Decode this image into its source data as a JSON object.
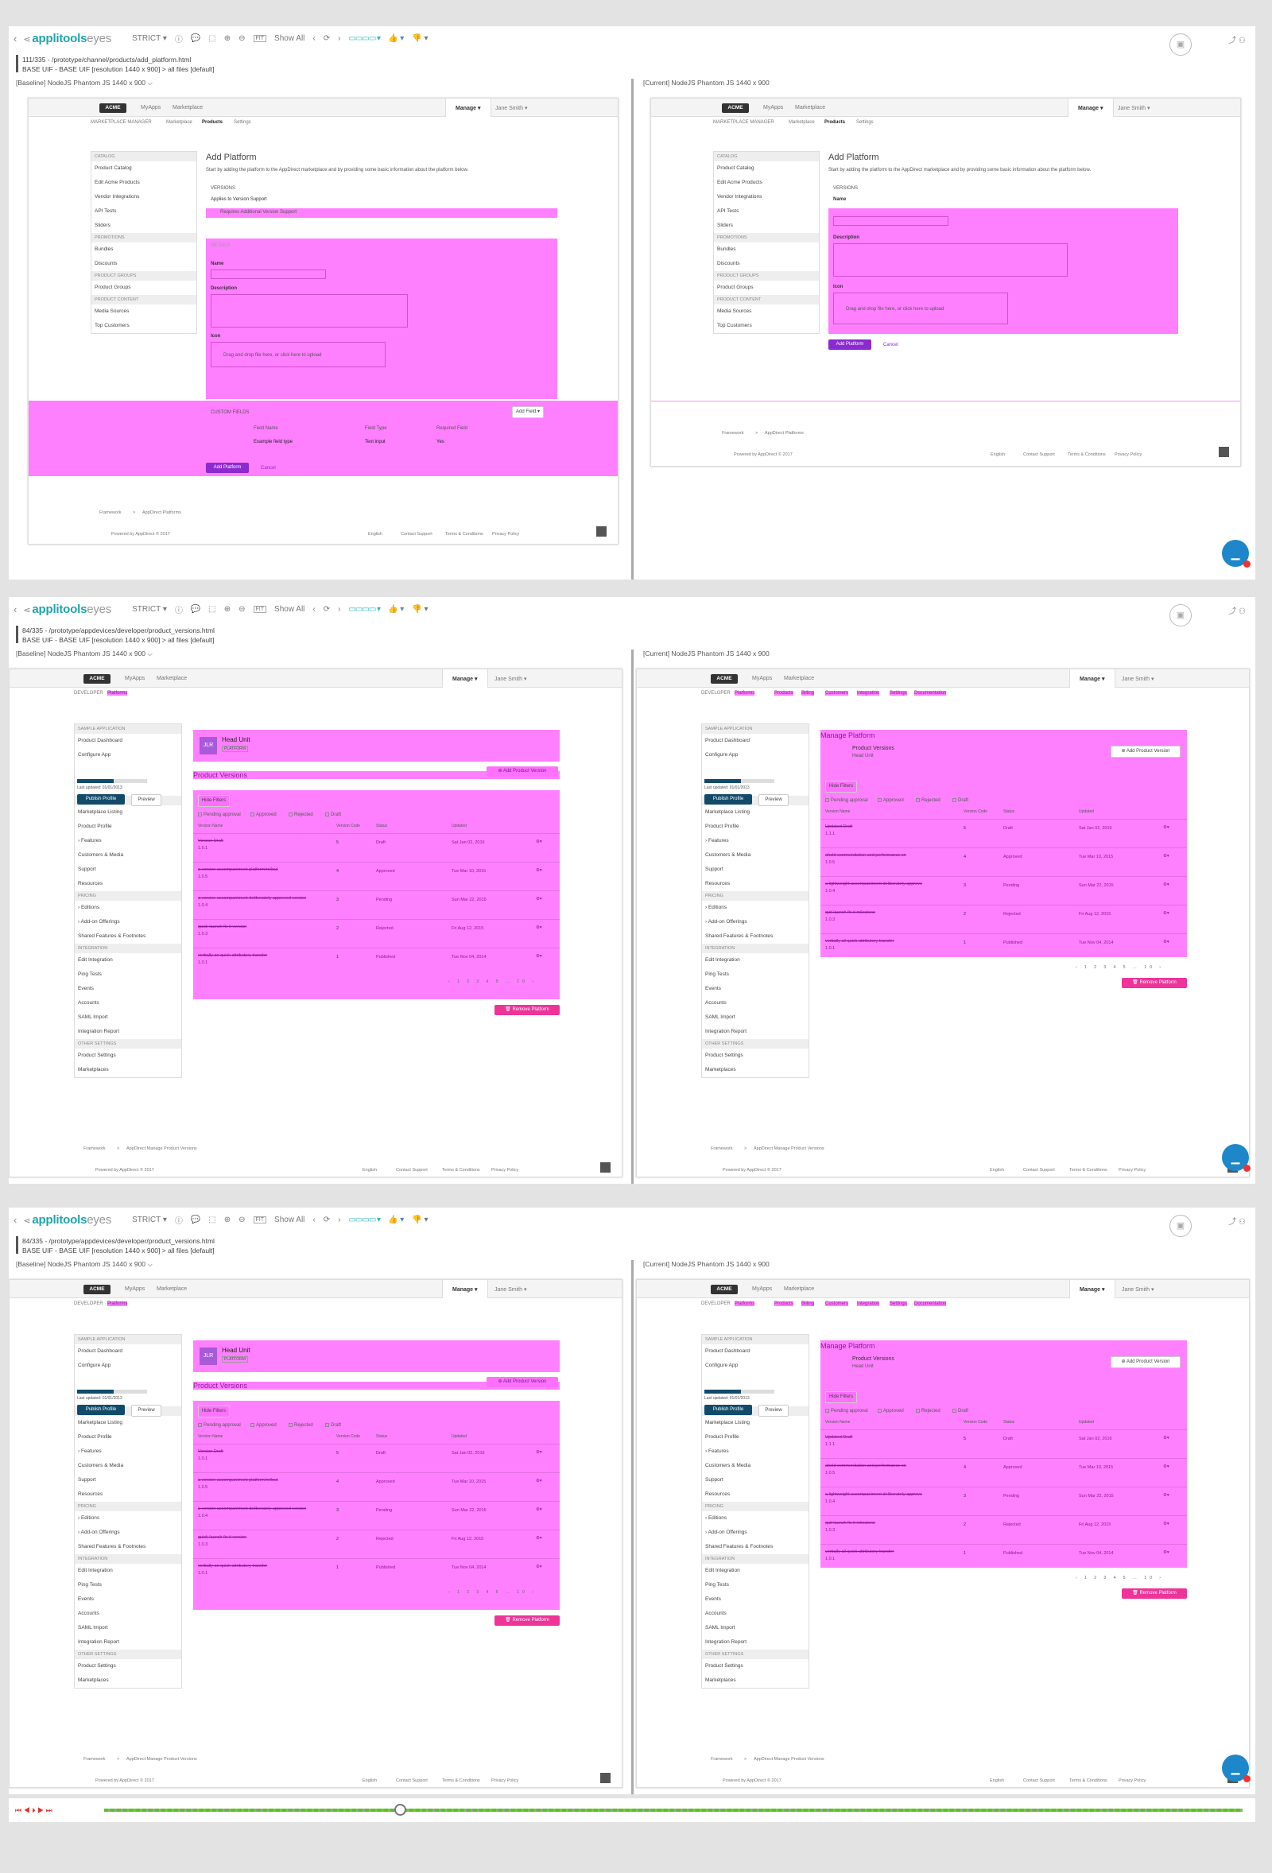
{
  "toolbar": {
    "app_name": "applitools",
    "app_suffix": "eyes",
    "match_level": "STRICT ▾",
    "fit_label": "FIT",
    "show_all": "Show All",
    "icons": [
      "back-chevron-icon",
      "info-icon",
      "comment-icon",
      "crop-icon",
      "zoom-in-icon",
      "zoom-out-icon",
      "prev-icon",
      "next-icon",
      "layout-icon",
      "thumbs-up-icon",
      "thumbs-down-icon",
      "share-icon",
      "users-icon",
      "save-disk-icon"
    ]
  },
  "frames": [
    {
      "path_line": "111/335  -  /prototype/channel/products/add_platform.html",
      "meta_line": "BASE UIF - BASE UIF [resolution 1440 x 900] > all files [default]",
      "baseline_header": "[Baseline]   NodeJS    Phantom JS    1440 x 900   ⌵",
      "current_header": "[Current]   NodeJS    Phantom JS    1440 x 900"
    },
    {
      "path_line": "84/335  -  /prototype/appdevices/developer/product_versions.html",
      "meta_line": "BASE UIF - BASE UIF [resolution 1440 x 900] > all files [default]",
      "baseline_header": "[Baseline]   NodeJS    Phantom JS    1440 x 900   ⌵",
      "current_header": "[Current]   NodeJS    Phantom JS    1440 x 900"
    },
    {
      "path_line": "84/335  -  /prototype/appdevices/developer/product_versions.html",
      "meta_line": "BASE UIF - BASE UIF [resolution 1440 x 900] > all files [default]",
      "baseline_header": "[Baseline]   NodeJS    Phantom JS    1440 x 900   ⌵",
      "current_header": "[Current]   NodeJS    Phantom JS    1440 x 900"
    }
  ],
  "app": {
    "logo": "ACME",
    "nav_myapps": "MyApps",
    "nav_marketplace": "Marketplace",
    "manage": "Manage ▾",
    "user": "Jane Smith ▾",
    "footer_framework": "Framework",
    "footer_sep": ">",
    "footer_powered": "Powered by AppDirect © 2017",
    "footer_english": "English",
    "footer_contact": "Contact Support",
    "footer_terms": "Terms & Conditions",
    "footer_privacy": "Privacy Policy"
  },
  "platform": {
    "subnav_manager": "MARKETPLACE MANAGER",
    "subnav_marketplace": "Marketplace",
    "subnav_products": "Products",
    "subnav_settings": "Settings",
    "title": "Add Platform",
    "description": "Start by adding the platform to the AppDirect marketplace and by providing some basic information about the platform below.",
    "versions": "VERSIONS",
    "applies_to": "Applies to Version Support",
    "requires_additional": "Requires Additional Version Support",
    "details": "DETAILS",
    "name": "Name",
    "description_label": "Description",
    "icon": "Icon",
    "upload": "Drag and drop file here, or click here to upload",
    "custom_fields": "CUSTOM FIELDS",
    "add_field": "Add Field ▾",
    "col_field_name": "Field Name",
    "col_field_type": "Field Type",
    "col_required": "Required Field",
    "row_field_name": "Example field type",
    "row_field_type": "Text input",
    "row_required": "Yes",
    "add_button": "Add Platform",
    "cancel": "Cancel",
    "breadcrumb": "AppDirect Platforms",
    "sidebar": [
      {
        "type": "sec",
        "label": "CATALOG"
      },
      {
        "type": "it",
        "label": "Product Catalog"
      },
      {
        "type": "it",
        "label": "Edit Acme Products"
      },
      {
        "type": "it",
        "label": "Vendor Integrations"
      },
      {
        "type": "it",
        "label": "API Tests"
      },
      {
        "type": "it",
        "label": "Sliders"
      },
      {
        "type": "sec",
        "label": "PROMOTIONS"
      },
      {
        "type": "it",
        "label": "Bundles"
      },
      {
        "type": "it",
        "label": "Discounts"
      },
      {
        "type": "sec",
        "label": "PRODUCT GROUPS"
      },
      {
        "type": "it",
        "label": "Product Groups"
      },
      {
        "type": "sec",
        "label": "PRODUCT CONTENT"
      },
      {
        "type": "it",
        "label": "Media Sources"
      },
      {
        "type": "it",
        "label": "Top Customers"
      }
    ]
  },
  "versions": {
    "subnav_developer": "DEVELOPER",
    "subnav_platforms": "Platforms",
    "current_tabs": [
      "Platforms",
      "Products",
      "Billing",
      "Customers",
      "Integration",
      "Settings",
      "Documentation"
    ],
    "head_unit": "Head Unit",
    "platform_tag": "PLATFORM",
    "jlr": "JLR",
    "product_versions": "Product Versions",
    "add_version": "⊕ Add Product Version",
    "hide_filters": "Hide Filters",
    "filter_pending": "Pending approval",
    "filter_approved": "Approved",
    "filter_rejected": "Rejected",
    "filter_draft": "Draft",
    "col_name": "Version Name",
    "col_code": "Version Code",
    "col_status": "Status",
    "col_updated": "Updated",
    "manage_platform": "Manage Platform",
    "remove": "🗑 Remove Platform",
    "last_updated": "Last updated: 01/01/2013",
    "publish": "Publish Profile",
    "preview": "Preview",
    "breadcrumb": "AppDirect Manage Product Versions",
    "pagination": "‹ 1 2 3 4 5 … 10 ›",
    "baseline_rows": [
      {
        "name": "Version Draft",
        "sub": "1.0.1",
        "code": "5",
        "status": "Draft",
        "updated": "Sat Jan 02, 2016"
      },
      {
        "name": "a version accompaniment platform/rollout",
        "sub": "1.0.5",
        "code": "4",
        "status": "Approved",
        "updated": "Tue Mar 10, 2015"
      },
      {
        "name": "a version accompaniment deliberately approved version",
        "sub": "1.0.4",
        "code": "3",
        "status": "Pending",
        "updated": "Sun Mar 22, 2015"
      },
      {
        "name": "quick launch fix it version",
        "sub": "1.0.3",
        "code": "2",
        "status": "Rejected",
        "updated": "Fri Aug 12, 2015"
      },
      {
        "name": "verbally an quick attributory transfer",
        "sub": "1.0.1",
        "code": "1",
        "status": "Published",
        "updated": "Tue Nov 04, 2014"
      }
    ],
    "current_rows": [
      {
        "name": "Updated Draft",
        "sub": "1.1.1",
        "code": "5",
        "status": "Draft",
        "updated": "Sat Jan 02, 2016"
      },
      {
        "name": "ahold commendation and performance on",
        "sub": "1.0.5",
        "code": "4",
        "status": "Approved",
        "updated": "Tue Mar 10, 2015"
      },
      {
        "name": "a lightweight accompaniment deliberately approve",
        "sub": "1.0.4",
        "code": "3",
        "status": "Pending",
        "updated": "Sun Mar 22, 2015"
      },
      {
        "name": "quit launch fix it milestone",
        "sub": "1.0.3",
        "code": "2",
        "status": "Rejected",
        "updated": "Fri Aug 12, 2015"
      },
      {
        "name": "verbally all quick attributory transfer",
        "sub": "1.0.1",
        "code": "1",
        "status": "Published",
        "updated": "Tue Nov 04, 2014"
      }
    ],
    "sidebar": [
      {
        "type": "sec",
        "label": "SAMPLE APPLICATION"
      },
      {
        "type": "it",
        "label": "Product Dashboard"
      },
      {
        "type": "it",
        "label": "Configure App"
      },
      {
        "type": "gap",
        "label": ""
      },
      {
        "type": "sec",
        "label": "PROFILE & BRANDING"
      },
      {
        "type": "it",
        "label": "Marketplace Listing"
      },
      {
        "type": "it",
        "label": "Product Profile"
      },
      {
        "type": "it",
        "label": "› Features"
      },
      {
        "type": "it",
        "label": "Customers & Media"
      },
      {
        "type": "it",
        "label": "Support"
      },
      {
        "type": "it",
        "label": "Resources"
      },
      {
        "type": "sec",
        "label": "PRICING"
      },
      {
        "type": "it",
        "label": "› Editions"
      },
      {
        "type": "it",
        "label": "› Add-on Offerings"
      },
      {
        "type": "it",
        "label": "Shared Features & Footnotes"
      },
      {
        "type": "sec",
        "label": "INTEGRATION"
      },
      {
        "type": "it",
        "label": "Edit Integration"
      },
      {
        "type": "it",
        "label": "Ping Tests"
      },
      {
        "type": "it",
        "label": "Events"
      },
      {
        "type": "it",
        "label": "Accounts"
      },
      {
        "type": "it",
        "label": "SAML Import"
      },
      {
        "type": "it",
        "label": "Integration Report"
      },
      {
        "type": "sec",
        "label": "OTHER SETTINGS"
      },
      {
        "type": "it",
        "label": "Product Settings"
      },
      {
        "type": "it",
        "label": "Marketplaces"
      }
    ]
  },
  "playback": {
    "controls": "⏮ ◀ ⏵ ▶ ⏭",
    "position": 0.26
  },
  "colors": {
    "diff": "#ff80ff",
    "accent": "#1fa5ab",
    "publish": "#124b6a",
    "remove": "#ee3399"
  }
}
